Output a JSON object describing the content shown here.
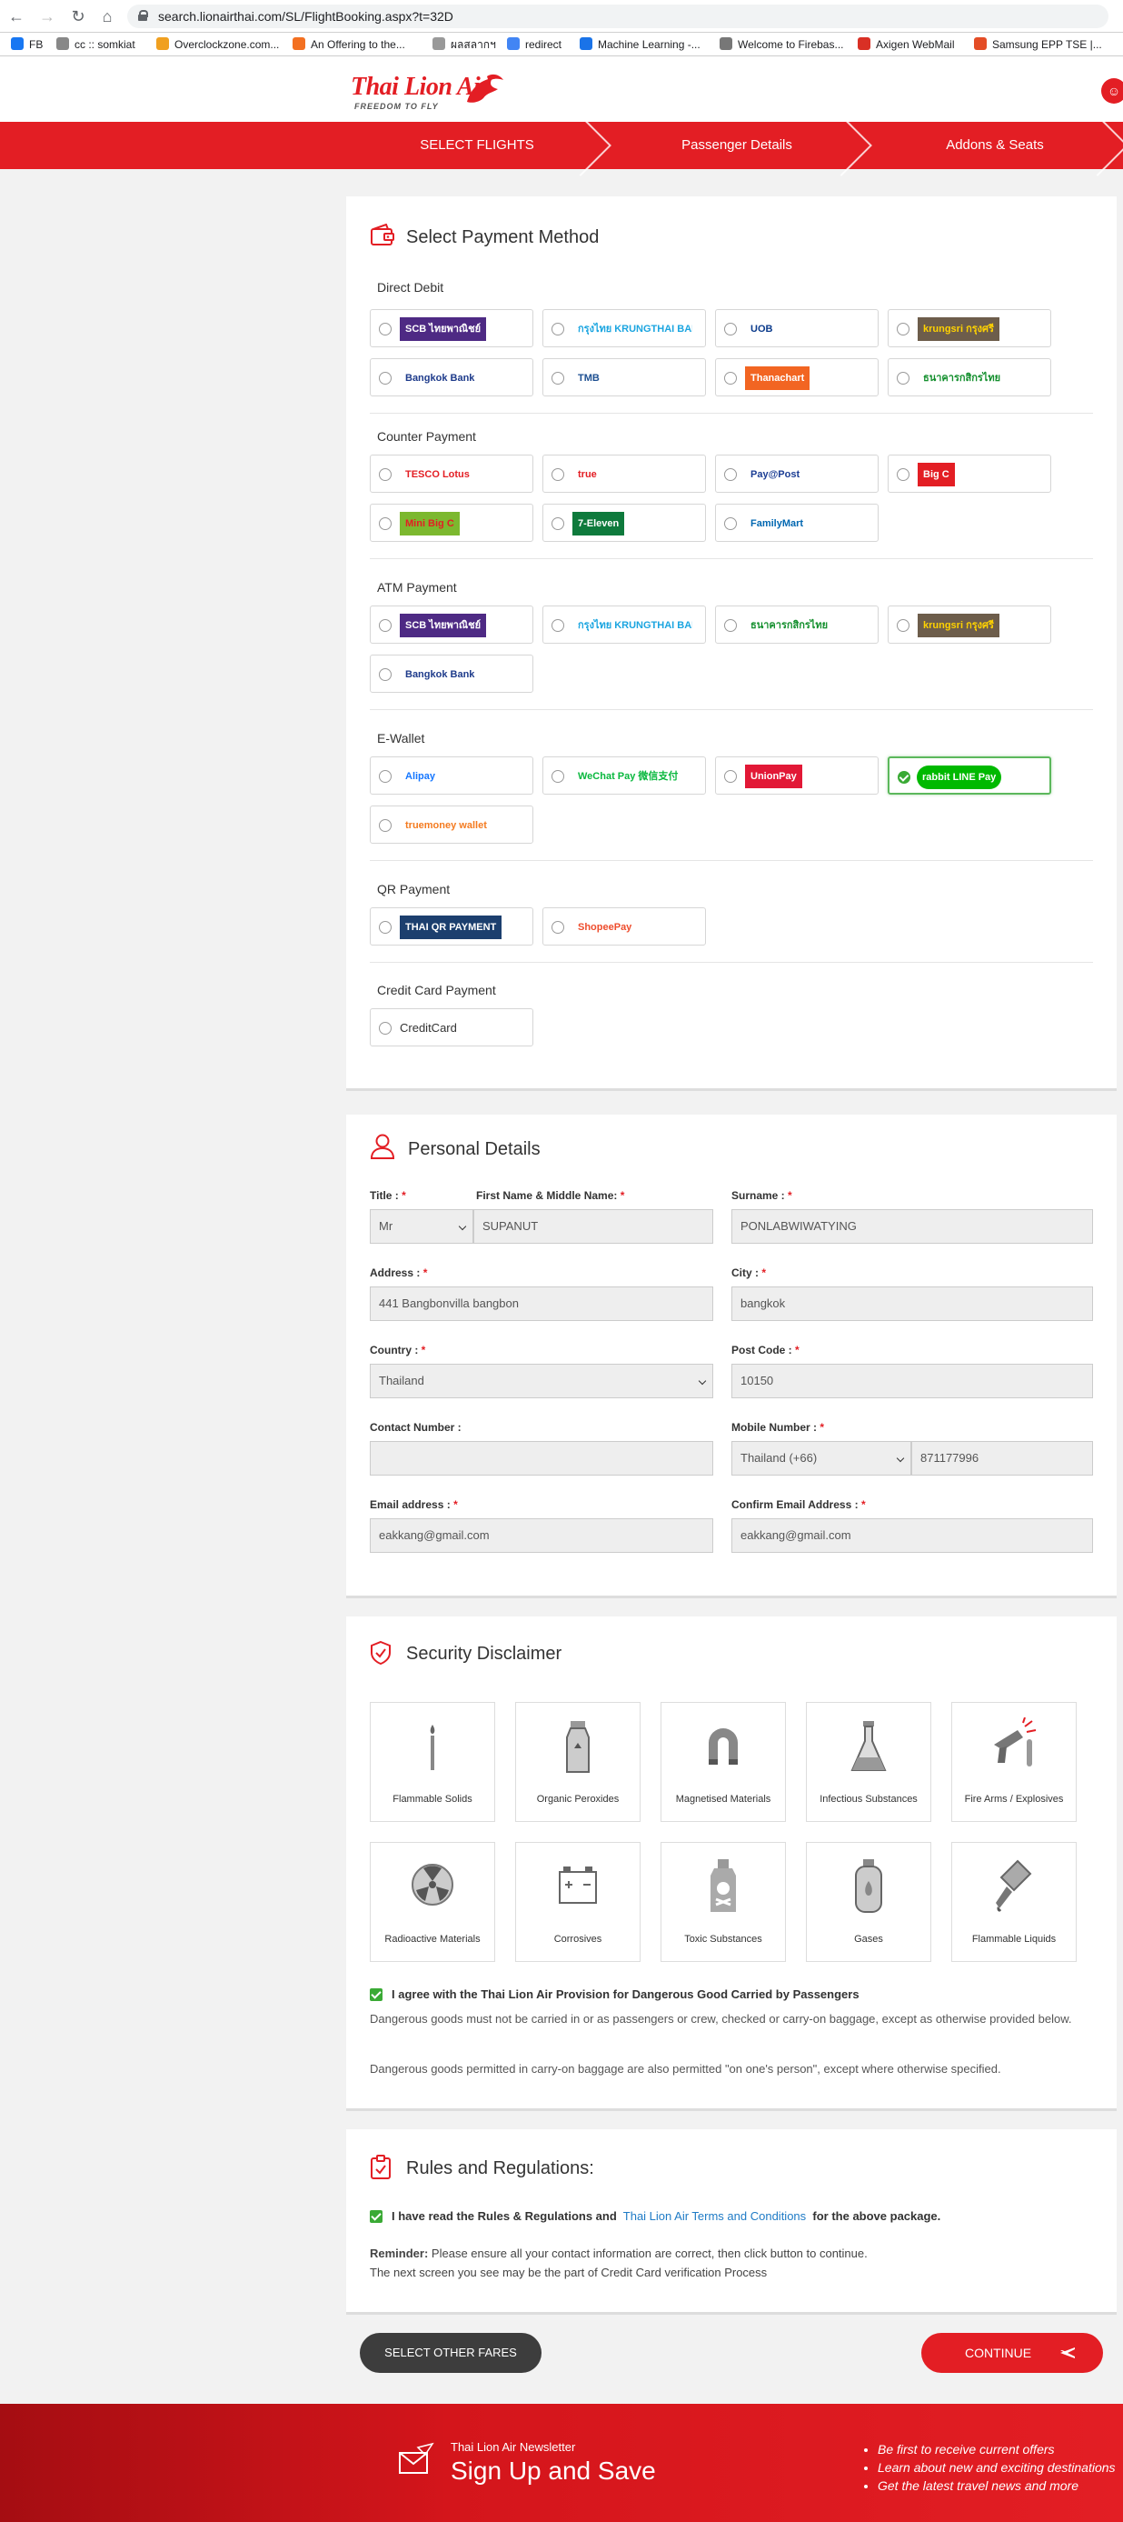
{
  "browser": {
    "url": "search.lionairthai.com/SL/FlightBooking.aspx?t=32D",
    "bookmarks": [
      {
        "label": "FB",
        "color": "#1877f2"
      },
      {
        "label": "cc :: somkiat",
        "color": "#888888"
      },
      {
        "label": "Overclockzone.com...",
        "color": "#f0a020"
      },
      {
        "label": "An Offering to the...",
        "color": "#f37021"
      },
      {
        "label": "ผลสลากฯ",
        "color": "#999999"
      },
      {
        "label": "redirect",
        "color": "#4285f4"
      },
      {
        "label": "Machine Learning -...",
        "color": "#1a73e8"
      },
      {
        "label": "Welcome to Firebas...",
        "color": "#777777"
      },
      {
        "label": "Axigen WebMail",
        "color": "#d93025"
      },
      {
        "label": "Samsung EPP TSE |...",
        "color": "#e44d26"
      }
    ]
  },
  "header": {
    "logo": "Thai Lion Air",
    "tagline": "FREEDOM TO FLY",
    "steps": [
      "SELECT FLIGHTS",
      "Passenger Details",
      "Addons & Seats"
    ]
  },
  "payment": {
    "title": "Select Payment Method",
    "groups": [
      {
        "label": "Direct Debit",
        "options": [
          {
            "name": "SCB ไทยพาณิชย์",
            "color": "#4e2a84",
            "text_color": "#ffffff"
          },
          {
            "name": "กรุงไทย KRUNGTHAI BANK",
            "color": "#ffffff",
            "text_color": "#1ba5e0"
          },
          {
            "name": "UOB",
            "color": "#ffffff",
            "text_color": "#0b3b8c"
          },
          {
            "name": "krungsri กรุงศรี",
            "color": "#6d5d4b",
            "text_color": "#ffd200"
          },
          {
            "name": "Bangkok Bank",
            "color": "#ffffff",
            "text_color": "#1e3b8b"
          },
          {
            "name": "TMB",
            "color": "#ffffff",
            "text_color": "#1d4f91"
          },
          {
            "name": "Thanachart",
            "color": "#f26522",
            "text_color": "#ffffff"
          },
          {
            "name": "ธนาคารกสิกรไทย",
            "color": "#ffffff",
            "text_color": "#138f2d"
          }
        ]
      },
      {
        "label": "Counter Payment",
        "options": [
          {
            "name": "TESCO Lotus",
            "color": "#ffffff",
            "text_color": "#e31e24"
          },
          {
            "name": "true",
            "color": "#ffffff",
            "text_color": "#e31e24"
          },
          {
            "name": "Pay@Post",
            "color": "#ffffff",
            "text_color": "#1b3d94"
          },
          {
            "name": "Big C",
            "color": "#e31e24",
            "text_color": "#ffffff"
          },
          {
            "name": "Mini Big C",
            "color": "#7cb82f",
            "text_color": "#e31e24"
          },
          {
            "name": "7-Eleven",
            "color": "#0e7a3c",
            "text_color": "#ffffff"
          },
          {
            "name": "FamilyMart",
            "color": "#ffffff",
            "text_color": "#0067b1"
          }
        ]
      },
      {
        "label": "ATM Payment",
        "options": [
          {
            "name": "SCB ไทยพาณิชย์",
            "color": "#4e2a84",
            "text_color": "#ffffff"
          },
          {
            "name": "กรุงไทย KRUNGTHAI BANK",
            "color": "#ffffff",
            "text_color": "#1ba5e0"
          },
          {
            "name": "ธนาคารกสิกรไทย",
            "color": "#ffffff",
            "text_color": "#138f2d"
          },
          {
            "name": "krungsri กรุงศรี",
            "color": "#6d5d4b",
            "text_color": "#ffd200"
          },
          {
            "name": "Bangkok Bank",
            "color": "#ffffff",
            "text_color": "#1e3b8b"
          }
        ]
      },
      {
        "label": "E-Wallet",
        "options": [
          {
            "name": "Alipay",
            "color": "#ffffff",
            "text_color": "#1677ff"
          },
          {
            "name": "WeChat Pay 微信支付",
            "color": "#ffffff",
            "text_color": "#09b83e"
          },
          {
            "name": "UnionPay",
            "color": "#e21836",
            "text_color": "#ffffff"
          },
          {
            "name": "rabbit LINE Pay",
            "color": "#00b900",
            "text_color": "#ffffff",
            "selected": true
          },
          {
            "name": "truemoney wallet",
            "color": "#ffffff",
            "text_color": "#f47b20"
          }
        ]
      },
      {
        "label": "QR Payment",
        "options": [
          {
            "name": "THAI QR PAYMENT",
            "color": "#1c3f6e",
            "text_color": "#ffffff"
          },
          {
            "name": "ShopeePay",
            "color": "#ffffff",
            "text_color": "#ee4d2d"
          }
        ]
      },
      {
        "label": "Credit Card Payment",
        "options": [
          {
            "name": "CreditCard",
            "color": "#ffffff",
            "text_color": "#333333",
            "plain": true
          }
        ]
      }
    ]
  },
  "personal": {
    "title": "Personal Details",
    "fields": {
      "title": {
        "label": "Title :",
        "value": "Mr"
      },
      "first_name": {
        "label": "First Name & Middle Name:",
        "value": "SUPANUT"
      },
      "surname": {
        "label": "Surname :",
        "value": "PONLABWIWATYING"
      },
      "address": {
        "label": "Address :",
        "value": "441 Bangbonvilla bangbon"
      },
      "city": {
        "label": "City :",
        "value": "bangkok"
      },
      "country": {
        "label": "Country :",
        "value": "Thailand"
      },
      "post_code": {
        "label": "Post Code :",
        "value": "10150"
      },
      "contact": {
        "label": "Contact Number :",
        "value": ""
      },
      "mobile": {
        "label": "Mobile Number :",
        "code": "Thailand (+66)",
        "value": "871177996"
      },
      "email": {
        "label": "Email address :",
        "value": "eakkang@gmail.com"
      },
      "confirm_email": {
        "label": "Confirm Email Address :",
        "value": "eakkang@gmail.com"
      }
    }
  },
  "security": {
    "title": "Security Disclaimer",
    "items": [
      "Flammable Solids",
      "Organic Peroxides",
      "Magnetised Materials",
      "Infectious Substances",
      "Fire Arms / Explosives",
      "Radioactive Materials",
      "Corrosives",
      "Toxic Substances",
      "Gases",
      "Flammable Liquids"
    ],
    "agree": "I agree with the Thai Lion Air Provision for Dangerous Good Carried by Passengers",
    "text1": "Dangerous goods must not be carried in or as passengers or crew, checked or carry-on baggage, except as otherwise provided below.",
    "text2": "Dangerous goods permitted in carry-on baggage are also permitted \"on one's person\", except where otherwise specified."
  },
  "rules": {
    "title": "Rules and Regulations:",
    "read_prefix": "I have read the Rules & Regulations and",
    "terms_link": "Thai Lion Air Terms and Conditions",
    "read_suffix": "for the above package.",
    "reminder_label": "Reminder:",
    "reminder_text": "Please ensure all your contact information are correct, then click button to continue.",
    "reminder_text2": "The next screen you see may be the part of Credit Card verification Process"
  },
  "actions": {
    "back": "SELECT OTHER FARES",
    "continue": "CONTINUE"
  },
  "footer": {
    "small": "Thai Lion Air Newsletter",
    "big": "Sign Up and Save",
    "bullets": [
      "Be first to receive current offers",
      "Learn about new and exciting destinations",
      "Get the latest travel news and more"
    ]
  }
}
